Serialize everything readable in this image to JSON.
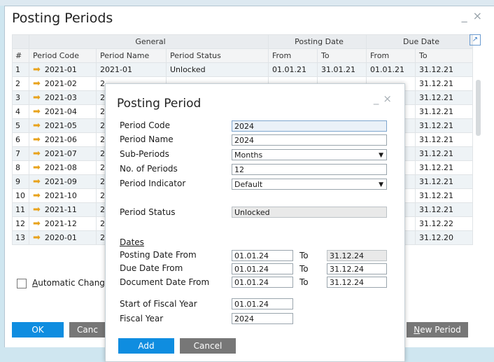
{
  "window": {
    "title": "Posting Periods"
  },
  "grid": {
    "groups": [
      {
        "label": "General"
      },
      {
        "label": "Posting Date"
      },
      {
        "label": "Due Date"
      }
    ],
    "columns": [
      "#",
      "Period Code",
      "Period Name",
      "Period Status",
      "From",
      "To",
      "From",
      "To"
    ],
    "rows": [
      {
        "n": "1",
        "code": "2021-01",
        "name": "2021-01",
        "status": "Unlocked",
        "pf": "01.01.21",
        "pt": "31.01.21",
        "df": "01.01.21",
        "dt": "31.12.21"
      },
      {
        "n": "2",
        "code": "2021-02",
        "name": "2",
        "status": "",
        "pf": "",
        "pt": "",
        "df": "",
        "dt": "31.12.21"
      },
      {
        "n": "3",
        "code": "2021-03",
        "name": "2",
        "status": "",
        "pf": "",
        "pt": "",
        "df": "",
        "dt": "31.12.21"
      },
      {
        "n": "4",
        "code": "2021-04",
        "name": "2",
        "status": "",
        "pf": "",
        "pt": "",
        "df": "",
        "dt": "31.12.21"
      },
      {
        "n": "5",
        "code": "2021-05",
        "name": "2",
        "status": "",
        "pf": "",
        "pt": "",
        "df": "",
        "dt": "31.12.21"
      },
      {
        "n": "6",
        "code": "2021-06",
        "name": "2",
        "status": "",
        "pf": "",
        "pt": "",
        "df": "",
        "dt": "31.12.21"
      },
      {
        "n": "7",
        "code": "2021-07",
        "name": "2",
        "status": "",
        "pf": "",
        "pt": "",
        "df": "",
        "dt": "31.12.21"
      },
      {
        "n": "8",
        "code": "2021-08",
        "name": "2",
        "status": "",
        "pf": "",
        "pt": "",
        "df": "",
        "dt": "31.12.21"
      },
      {
        "n": "9",
        "code": "2021-09",
        "name": "2",
        "status": "",
        "pf": "",
        "pt": "",
        "df": "",
        "dt": "31.12.21"
      },
      {
        "n": "10",
        "code": "2021-10",
        "name": "2",
        "status": "",
        "pf": "",
        "pt": "",
        "df": "",
        "dt": "31.12.21"
      },
      {
        "n": "11",
        "code": "2021-11",
        "name": "2",
        "status": "",
        "pf": "",
        "pt": "",
        "df": "",
        "dt": "31.12.21"
      },
      {
        "n": "12",
        "code": "2021-12",
        "name": "2",
        "status": "",
        "pf": "",
        "pt": "",
        "df": "",
        "dt": "31.12.22"
      },
      {
        "n": "13",
        "code": "2020-01",
        "name": "2",
        "status": "",
        "pf": "",
        "pt": "",
        "df": "",
        "dt": "31.12.20"
      }
    ]
  },
  "auto_change": {
    "label_first": "A",
    "label_rest": "utomatic Change ("
  },
  "buttons": {
    "ok": "OK",
    "cancel_partial": "Canc",
    "new_period_first": "N",
    "new_period_rest": "ew Period"
  },
  "modal": {
    "title": "Posting Period",
    "period_code_label": "Period Code",
    "period_code": "2024",
    "period_name_label": "Period Name",
    "period_name": "2024",
    "sub_periods_label": "Sub-Periods",
    "sub_periods": "Months",
    "no_periods_label": "No. of Periods",
    "no_periods": "12",
    "period_indicator_label": "Period Indicator",
    "period_indicator": "Default",
    "period_status_label": "Period Status",
    "period_status": "Unlocked",
    "dates_label": "Dates",
    "posting_from_label": "Posting Date From",
    "posting_from": "01.01.24",
    "posting_to": "31.12.24",
    "due_from_label": "Due Date From",
    "due_from": "01.01.24",
    "due_to": "31.12.24",
    "doc_from_label": "Document Date From",
    "doc_from": "01.01.24",
    "doc_to": "31.12.24",
    "to_label": "To",
    "fiscal_start_label": "Start of Fiscal Year",
    "fiscal_start": "01.01.24",
    "fiscal_year_label": "Fiscal Year",
    "fiscal_year": "2024",
    "add": "Add",
    "cancel": "Cancel"
  },
  "colors": {
    "accent": "#0f8de0",
    "arrow": "#e8a21a",
    "button_gray": "#777777"
  }
}
